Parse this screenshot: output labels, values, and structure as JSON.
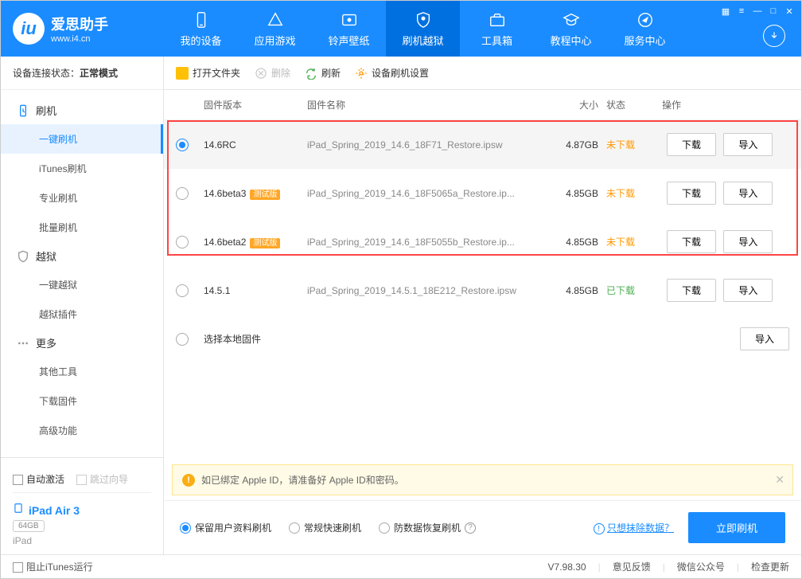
{
  "logo": {
    "title": "爱思助手",
    "sub": "www.i4.cn"
  },
  "nav": [
    {
      "label": "我的设备"
    },
    {
      "label": "应用游戏"
    },
    {
      "label": "铃声壁纸"
    },
    {
      "label": "刷机越狱"
    },
    {
      "label": "工具箱"
    },
    {
      "label": "教程中心"
    },
    {
      "label": "服务中心"
    }
  ],
  "sidebar": {
    "status_label": "设备连接状态：",
    "status_value": "正常模式",
    "groups": [
      {
        "title": "刷机",
        "items": [
          "一键刷机",
          "iTunes刷机",
          "专业刷机",
          "批量刷机"
        ]
      },
      {
        "title": "越狱",
        "items": [
          "一键越狱",
          "越狱插件"
        ]
      },
      {
        "title": "更多",
        "items": [
          "其他工具",
          "下载固件",
          "高级功能"
        ]
      }
    ],
    "activate": "自动激活",
    "skip": "跳过向导",
    "device_name": "iPad Air 3",
    "device_storage": "64GB",
    "device_type": "iPad"
  },
  "toolbar": {
    "open": "打开文件夹",
    "delete": "删除",
    "refresh": "刷新",
    "settings": "设备刷机设置"
  },
  "table": {
    "headers": {
      "version": "固件版本",
      "name": "固件名称",
      "size": "大小",
      "status": "状态",
      "ops": "操作"
    },
    "download_label": "下载",
    "import_label": "导入",
    "beta_badge": "测试版",
    "local_label": "选择本地固件",
    "rows": [
      {
        "version": "14.6RC",
        "beta": false,
        "name": "iPad_Spring_2019_14.6_18F71_Restore.ipsw",
        "size": "4.87GB",
        "status": "未下载",
        "st": "no",
        "sel": true
      },
      {
        "version": "14.6beta3",
        "beta": true,
        "name": "iPad_Spring_2019_14.6_18F5065a_Restore.ip...",
        "size": "4.85GB",
        "status": "未下载",
        "st": "no",
        "sel": false
      },
      {
        "version": "14.6beta2",
        "beta": true,
        "name": "iPad_Spring_2019_14.6_18F5055b_Restore.ip...",
        "size": "4.85GB",
        "status": "未下载",
        "st": "no",
        "sel": false
      },
      {
        "version": "14.5.1",
        "beta": false,
        "name": "iPad_Spring_2019_14.5.1_18E212_Restore.ipsw",
        "size": "4.85GB",
        "status": "已下载",
        "st": "yes",
        "sel": false
      }
    ]
  },
  "notice": "如已绑定 Apple ID，请准备好 Apple ID和密码。",
  "options": {
    "o1": "保留用户资料刷机",
    "o2": "常规快速刷机",
    "o3": "防数据恢复刷机",
    "erase_link": "只想抹除数据？",
    "flash": "立即刷机"
  },
  "footer": {
    "block_itunes": "阻止iTunes运行",
    "version": "V7.98.30",
    "feedback": "意见反馈",
    "wechat": "微信公众号",
    "update": "检查更新"
  }
}
